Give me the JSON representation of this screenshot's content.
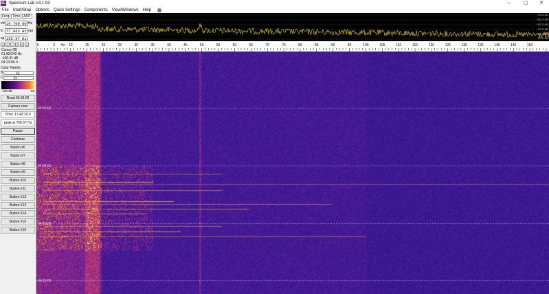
{
  "window": {
    "title": "Spectrum Lab V3.1 b3",
    "app_icon": "SL",
    "minimize_icon": "–",
    "maximize_icon": "▢",
    "close_icon": "✕"
  },
  "menu": [
    "File",
    "Start/Stop",
    "Options",
    "Quick Settings",
    "Components",
    "View/Windows",
    "Help"
  ],
  "left_panel": {
    "tabs": [
      "Freq",
      "Time",
      "ADP"
    ],
    "fields": [
      {
        "label": "vfo",
        "value": "10 700 000",
        "unit": "Hz"
      },
      {
        "label": "fc",
        "value": "77.963  Hz",
        "unit": "opt"
      },
      {
        "label": "sp",
        "value": "155.97  Hz",
        "unit": ""
      }
    ],
    "freq_buttons": [
      "<",
      "<",
      "-",
      "+",
      ">",
      ">"
    ],
    "cursor_info": {
      "title": "Cursor [R]",
      "freq": "61.82/249 Hz",
      "level": "-100.41 dB",
      "time": "04:23:09.0"
    },
    "palette": {
      "title": "Color Palette",
      "slider_b": "B",
      "slider_c": "C",
      "min_label": "-100 dB",
      "max_label": "-50"
    },
    "buttons": [
      {
        "label": "Read 05:36:02",
        "style": "plain"
      },
      {
        "label": "Capture now",
        "style": "plain"
      },
      {
        "label": "Time:  17:42:10.0",
        "style": "boxed"
      },
      {
        "label": "peak at 765.57 Hz",
        "style": "boxed"
      },
      {
        "label": "Pause",
        "style": "pause"
      },
      {
        "label": "Continue",
        "style": "plain"
      },
      {
        "label": "Button #6",
        "style": "plain"
      },
      {
        "label": "Button #7",
        "style": "plain"
      },
      {
        "label": "Button #8",
        "style": "plain"
      },
      {
        "label": "Button #9",
        "style": "plain"
      },
      {
        "label": "Button #10",
        "style": "plain"
      },
      {
        "label": "Button #11",
        "style": "plain"
      },
      {
        "label": "Button #12",
        "style": "plain"
      },
      {
        "label": "Button #13",
        "style": "plain"
      },
      {
        "label": "Button #14",
        "style": "plain"
      },
      {
        "label": "Button #15",
        "style": "plain"
      },
      {
        "label": "Button #16",
        "style": "plain"
      }
    ]
  },
  "spectrum": {
    "db_labels": [
      "-40.0 dB",
      "-50.0 dB",
      "-60.0 dB",
      "-70.0 dB",
      "-80.0 dB",
      "-90.0 dB"
    ],
    "trace_color": "#e8d020"
  },
  "freq_scale": {
    "labels": [
      "0",
      "5",
      "10",
      "15",
      "20",
      "25",
      "30",
      "35",
      "40",
      "45",
      "50",
      "55",
      "60",
      "65",
      "70",
      "75",
      "80",
      "85",
      "90",
      "95",
      "100",
      "105",
      "110",
      "115",
      "120",
      "125",
      "130",
      "135",
      "140",
      "145",
      "150"
    ],
    "unit_label": "Hz",
    "max_hz": 155
  },
  "waterfall": {
    "time_labels": [
      "04:30:09",
      "04:23:01",
      "04:20:01",
      "04:15:09"
    ],
    "base_color": "#2c1580",
    "hot_color": "#ffb030"
  }
}
